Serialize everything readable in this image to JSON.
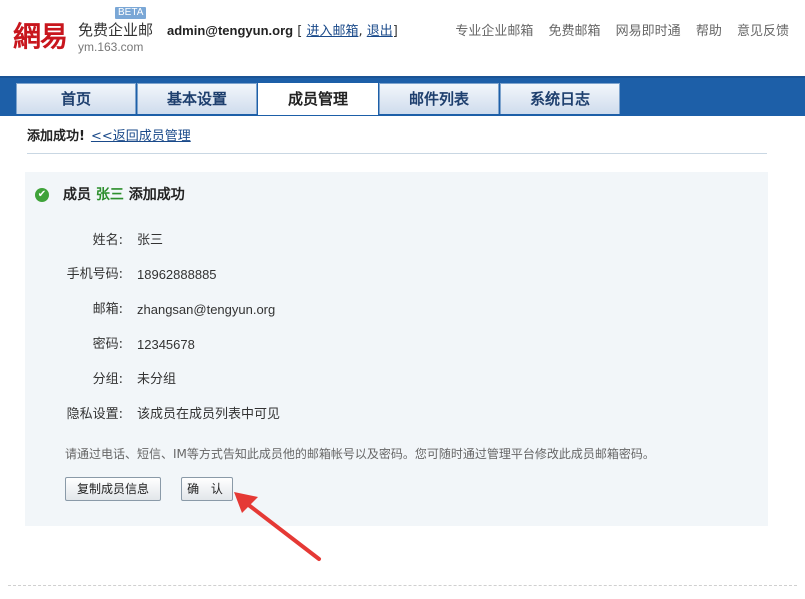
{
  "header": {
    "logo_mark": "網易",
    "product": "免费企业邮",
    "domain": "ym.163.com",
    "beta": "BETA",
    "user_email": "admin@tengyun.org",
    "bracket_open": "[",
    "enter_mail": "进入邮箱",
    "sep": ",",
    "logout": "退出",
    "bracket_close": "]",
    "top_links": [
      "专业企业邮箱",
      "免费邮箱",
      "网易即时通",
      "帮助",
      "意见反馈"
    ]
  },
  "nav": {
    "tabs": [
      "首页",
      "基本设置",
      "成员管理",
      "邮件列表",
      "系统日志"
    ],
    "active_index": 2
  },
  "breadcrumb": {
    "title": "添加成功!",
    "back_link": "<<返回成员管理"
  },
  "result": {
    "prefix": "成员",
    "name": "张三",
    "suffix": "添加成功",
    "fields": [
      {
        "label": "姓名:",
        "value": "张三"
      },
      {
        "label": "手机号码:",
        "value": "18962888885"
      },
      {
        "label": "邮箱:",
        "value": "zhangsan@tengyun.org"
      },
      {
        "label": "密码:",
        "value": "12345678"
      },
      {
        "label": "分组:",
        "value": "未分组"
      },
      {
        "label": "隐私设置:",
        "value": "该成员在成员列表中可见"
      }
    ],
    "note": "请通过电话、短信、IM等方式告知此成员他的邮箱帐号以及密码。您可随时通过管理平台修改此成员邮箱密码。",
    "copy_button": "复制成员信息",
    "confirm_button": "确 认"
  },
  "colors": {
    "nav_bar": "#1d5fa8",
    "logo_red": "#c8161d",
    "success_green": "#3fa33a",
    "arrow_red": "#e53935",
    "panel_bg": "#f2f6f9"
  }
}
